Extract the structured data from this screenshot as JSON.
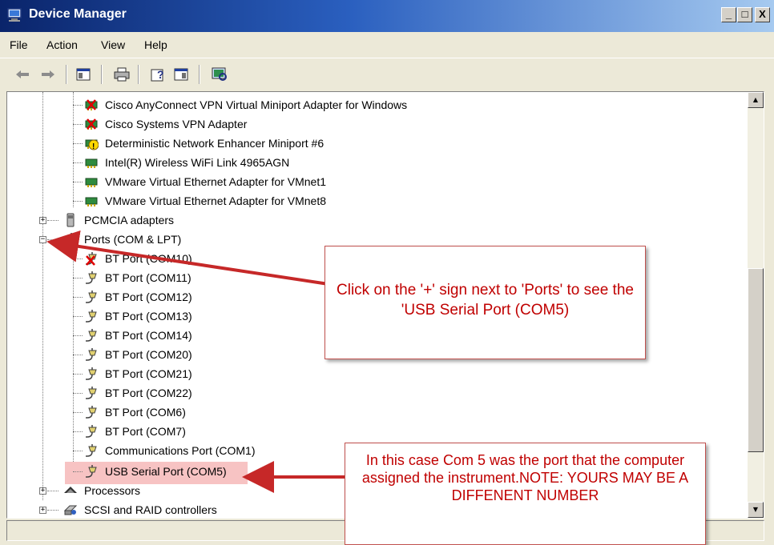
{
  "window": {
    "title": "Device Manager",
    "controls": {
      "minimize": "_",
      "maximize": "□",
      "close": "X"
    }
  },
  "menu": {
    "items": [
      "File",
      "Action",
      "View",
      "Help"
    ]
  },
  "toolbar": {
    "buttons": [
      "back-icon",
      "forward-icon",
      "show-hide-console-tree-icon",
      "print-icon",
      "help-icon",
      "properties-icon",
      "scan-hardware-icon"
    ]
  },
  "tree": {
    "network_adapters": [
      {
        "label": "Cisco AnyConnect VPN Virtual Miniport Adapter for Windows",
        "status": "disabled"
      },
      {
        "label": "Cisco Systems VPN Adapter",
        "status": "disabled"
      },
      {
        "label": "Deterministic Network Enhancer Miniport #6",
        "status": "warning"
      },
      {
        "label": "Intel(R) Wireless WiFi Link 4965AGN",
        "status": "ok"
      },
      {
        "label": "VMware Virtual Ethernet Adapter for VMnet1",
        "status": "ok"
      },
      {
        "label": "VMware Virtual Ethernet Adapter for VMnet8",
        "status": "ok"
      }
    ],
    "pcmcia": {
      "label": "PCMCIA adapters",
      "expander": "+"
    },
    "ports": {
      "label": "Ports (COM & LPT)",
      "expander": "−",
      "children": [
        {
          "label": "BT Port (COM10)",
          "status": "disabled"
        },
        {
          "label": "BT Port (COM11)",
          "status": "ok"
        },
        {
          "label": "BT Port (COM12)",
          "status": "ok"
        },
        {
          "label": "BT Port (COM13)",
          "status": "ok"
        },
        {
          "label": "BT Port (COM14)",
          "status": "ok"
        },
        {
          "label": "BT Port (COM20)",
          "status": "ok"
        },
        {
          "label": "BT Port (COM21)",
          "status": "ok"
        },
        {
          "label": "BT Port (COM22)",
          "status": "ok"
        },
        {
          "label": "BT Port (COM6)",
          "status": "ok"
        },
        {
          "label": "BT Port (COM7)",
          "status": "ok"
        },
        {
          "label": "Communications Port (COM1)",
          "status": "ok"
        },
        {
          "label": "USB Serial Port (COM5)",
          "status": "highlighted"
        }
      ]
    },
    "processors": {
      "label": "Processors",
      "expander": "+"
    },
    "scsi": {
      "label": "SCSI and RAID controllers",
      "expander": "+"
    }
  },
  "callouts": {
    "ports_hint": "Click on the '+' sign next to 'Ports' to see the 'USB Serial Port (COM5)",
    "com5_note": "In this case Com 5 was the port that the computer assigned the instrument.NOTE: YOURS MAY BE A DIFFENENT NUMBER"
  },
  "colors": {
    "title_gradient_start": "#0a246a",
    "title_gradient_end": "#a6caf0",
    "callout_text": "#c00000",
    "callout_border": "#c0504d",
    "arrow": "#c62828",
    "highlight": "#f7c3c3"
  }
}
